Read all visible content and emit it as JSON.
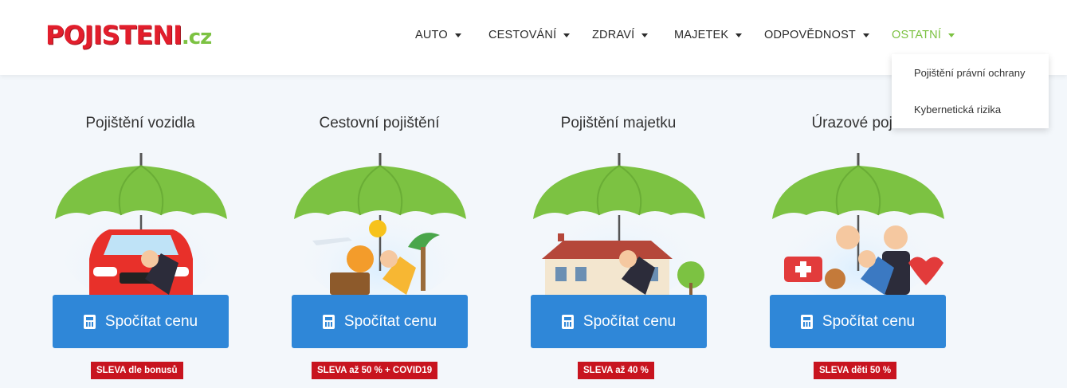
{
  "header": {
    "logo": {
      "main": "POJISTENI",
      "suffix": ".cz"
    }
  },
  "nav": {
    "items": [
      {
        "label": "AUTO"
      },
      {
        "label": "CESTOVÁNÍ"
      },
      {
        "label": "ZDRAVÍ"
      },
      {
        "label": "MAJETEK"
      },
      {
        "label": "ODPOVĚDNOST"
      },
      {
        "label": "OSTATNÍ",
        "active": true
      }
    ],
    "dropdown": {
      "items": [
        {
          "label": "Pojištění právní ochrany"
        },
        {
          "label": "Kybernetická rizika"
        }
      ]
    }
  },
  "cards": [
    {
      "title": "Pojištění vozidla",
      "button": "Spočítat cenu",
      "badge": "SLEVA dle bonusů",
      "illustration": "umbrella-car-icon"
    },
    {
      "title": "Cestovní pojištění",
      "button": "Spočítat cenu",
      "badge": "SLEVA až 50 % + COVID19",
      "illustration": "umbrella-travel-icon"
    },
    {
      "title": "Pojištění majetku",
      "button": "Spočítat cenu",
      "badge": "SLEVA až 40 %",
      "illustration": "umbrella-house-icon"
    },
    {
      "title": "Úrazové pojiš",
      "button": "Spočítat cenu",
      "badge": "SLEVA děti 50 %",
      "illustration": "umbrella-health-icon"
    }
  ],
  "colors": {
    "brand_red": "#e21e2c",
    "brand_green": "#7cc242",
    "button_blue": "#2f87d8",
    "badge_red": "#c8141f",
    "background": "#f3f7fb"
  }
}
